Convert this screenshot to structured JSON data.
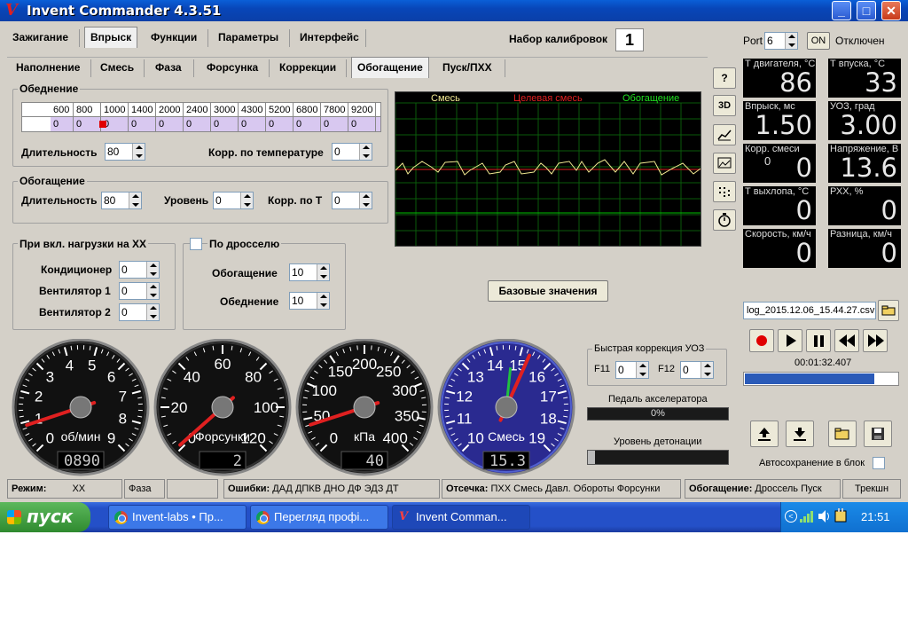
{
  "window": {
    "title": "Invent Commander 4.3.51"
  },
  "main_tabs": [
    "Зажигание",
    "Впрыск",
    "Функции",
    "Параметры",
    "Интерфейс"
  ],
  "calib": {
    "label": "Набор калибровок",
    "value": "1"
  },
  "port": {
    "label": "Port",
    "value": "6",
    "on_label": "ON",
    "status": "Отключен"
  },
  "sub_tabs": [
    "Наполнение",
    "Смесь",
    "Фаза",
    "Форсунка",
    "Коррекции",
    "Обогащение",
    "Пуск/ПХХ"
  ],
  "lean": {
    "title": "Обеднение",
    "rpm": [
      "600",
      "800",
      "1000",
      "1400",
      "2000",
      "2400",
      "3000",
      "4300",
      "5200",
      "6800",
      "7800",
      "9200"
    ],
    "vals": [
      "0",
      "0",
      "0",
      "0",
      "0",
      "0",
      "0",
      "0",
      "0",
      "0",
      "0",
      "0"
    ],
    "dur_label": "Длительность",
    "dur": "80",
    "temp_label": "Корр. по температуре",
    "temp": "0"
  },
  "enrich": {
    "title": "Обогащение",
    "dur_label": "Длительность",
    "dur": "80",
    "lvl_label": "Уровень",
    "lvl": "0",
    "corr_label": "Корр. по Т",
    "corr": "0"
  },
  "load": {
    "title": "При вкл. нагрузки на ХХ",
    "items": [
      {
        "label": "Кондиционер",
        "value": "0"
      },
      {
        "label": "Вентилятор 1",
        "value": "0"
      },
      {
        "label": "Вентилятор 2",
        "value": "0"
      }
    ]
  },
  "throttle": {
    "title": "По дросселю",
    "enrich_label": "Обогащение",
    "enrich": "10",
    "lean_label": "Обеднение",
    "lean": "10"
  },
  "scope": {
    "legend": [
      "Смесь",
      "Целевая смесь",
      "Обогащение"
    ]
  },
  "base_button": "Базовые значения",
  "side_buttons": [
    "?",
    "3D",
    "chart-icon",
    "image-icon",
    "grid-icon",
    "timer-icon"
  ],
  "tiles": [
    {
      "name": "Т двигателя, °С",
      "value": "86"
    },
    {
      "name": "Т впуска, °С",
      "value": "33"
    },
    {
      "name": "Впрыск, мс",
      "value": "1.50"
    },
    {
      "name": "УОЗ, град",
      "value": "3.00"
    },
    {
      "name": "Корр. смеси",
      "value": "0",
      "sub": "0"
    },
    {
      "name": "Напряжение, В",
      "value": "13.6"
    },
    {
      "name": "Т выхлопа, °С",
      "value": "0"
    },
    {
      "name": "РХХ, %",
      "value": "0"
    },
    {
      "name": "Скорость, км/ч",
      "value": "0"
    },
    {
      "name": "Разница, км/ч",
      "value": "0"
    }
  ],
  "log": {
    "file": "log_2015.12.06_15.44.27.csv",
    "time": "00:01:32.407",
    "progress": 0.85
  },
  "uoz": {
    "title": "Быстрая коррекция УОЗ",
    "f11_label": "F11",
    "f11": "0",
    "f12_label": "F12",
    "f12": "0"
  },
  "pedal": {
    "label": "Педаль акселератора",
    "value": "0%"
  },
  "knock": {
    "label": "Уровень детонации"
  },
  "autosave": "Автосохранение в блок",
  "gauges": [
    {
      "label": "об/мин",
      "ticks": [
        "0",
        "1",
        "2",
        "3",
        "4",
        "5",
        "6",
        "7",
        "8",
        "9"
      ],
      "digital": "0890",
      "value": 0.89
    },
    {
      "label": "Форсунки",
      "ticks": [
        "0",
        "20",
        "40",
        "60",
        "80",
        "100",
        "120"
      ],
      "digital": "2",
      "value": 1.5
    },
    {
      "label": "кПа",
      "ticks": [
        "0",
        "50",
        "100",
        "150",
        "200",
        "250",
        "300",
        "350",
        "400"
      ],
      "digital": "40",
      "value": 40
    },
    {
      "label": "Смесь",
      "ticks": [
        "10",
        "11",
        "12",
        "13",
        "14",
        "15",
        "16",
        "17",
        "18",
        "19"
      ],
      "digital": "15.3",
      "value": 15.3
    }
  ],
  "status": {
    "mode_label": "Режим:",
    "mode": "ХХ",
    "phase": "Фаза",
    "errors_label": "Ошибки:",
    "errors": "ДАД ДПКВ ДНО ДФ ЭДЗ ДТ",
    "cut_label": "Отсечка:",
    "cut": "ПХХ Смесь Давл. Обороты Форсунки",
    "enrich_label": "Обогащение:",
    "enrich": "Дроссель Пуск",
    "tail": "Трекшн"
  },
  "taskbar": {
    "start": "пуск",
    "tasks": [
      "Invent-labs • Пр...",
      "Перегляд профі...",
      "Invent Comman..."
    ],
    "clock": "21:51"
  }
}
